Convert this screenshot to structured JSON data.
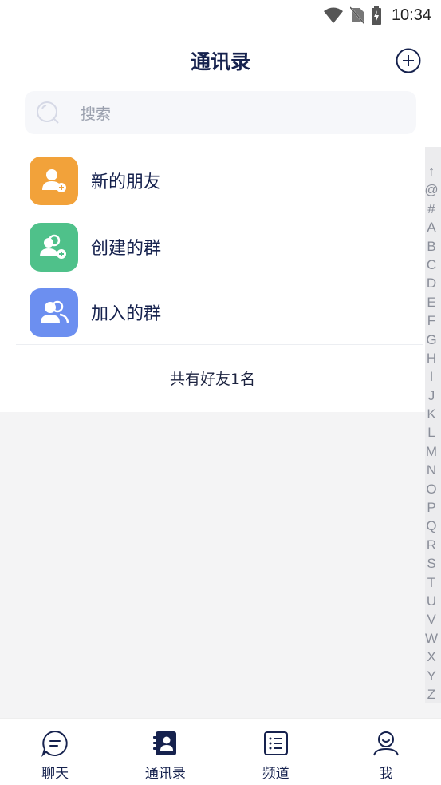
{
  "status_bar": {
    "time": "10:34"
  },
  "header": {
    "title": "通讯录"
  },
  "search": {
    "placeholder": "搜索"
  },
  "menu": {
    "items": [
      {
        "label": "新的朋友",
        "icon": "user-add-icon",
        "color": "#f2a23a"
      },
      {
        "label": "创建的群",
        "icon": "group-add-icon",
        "color": "#4fc18a"
      },
      {
        "label": "加入的群",
        "icon": "group-icon",
        "color": "#6c8ff0"
      }
    ]
  },
  "friend_count": "共有好友1名",
  "alpha_index": [
    "↑",
    "@",
    "#",
    "A",
    "B",
    "C",
    "D",
    "E",
    "F",
    "G",
    "H",
    "I",
    "J",
    "K",
    "L",
    "M",
    "N",
    "O",
    "P",
    "Q",
    "R",
    "S",
    "T",
    "U",
    "V",
    "W",
    "X",
    "Y",
    "Z"
  ],
  "bottom_nav": {
    "items": [
      {
        "label": "聊天",
        "icon": "chat-icon"
      },
      {
        "label": "通讯录",
        "icon": "contacts-icon",
        "active": true
      },
      {
        "label": "频道",
        "icon": "channel-list-icon"
      },
      {
        "label": "我",
        "icon": "profile-icon"
      }
    ]
  },
  "colors": {
    "primary": "#16224e",
    "accent_bg": "#f4f4f5"
  }
}
